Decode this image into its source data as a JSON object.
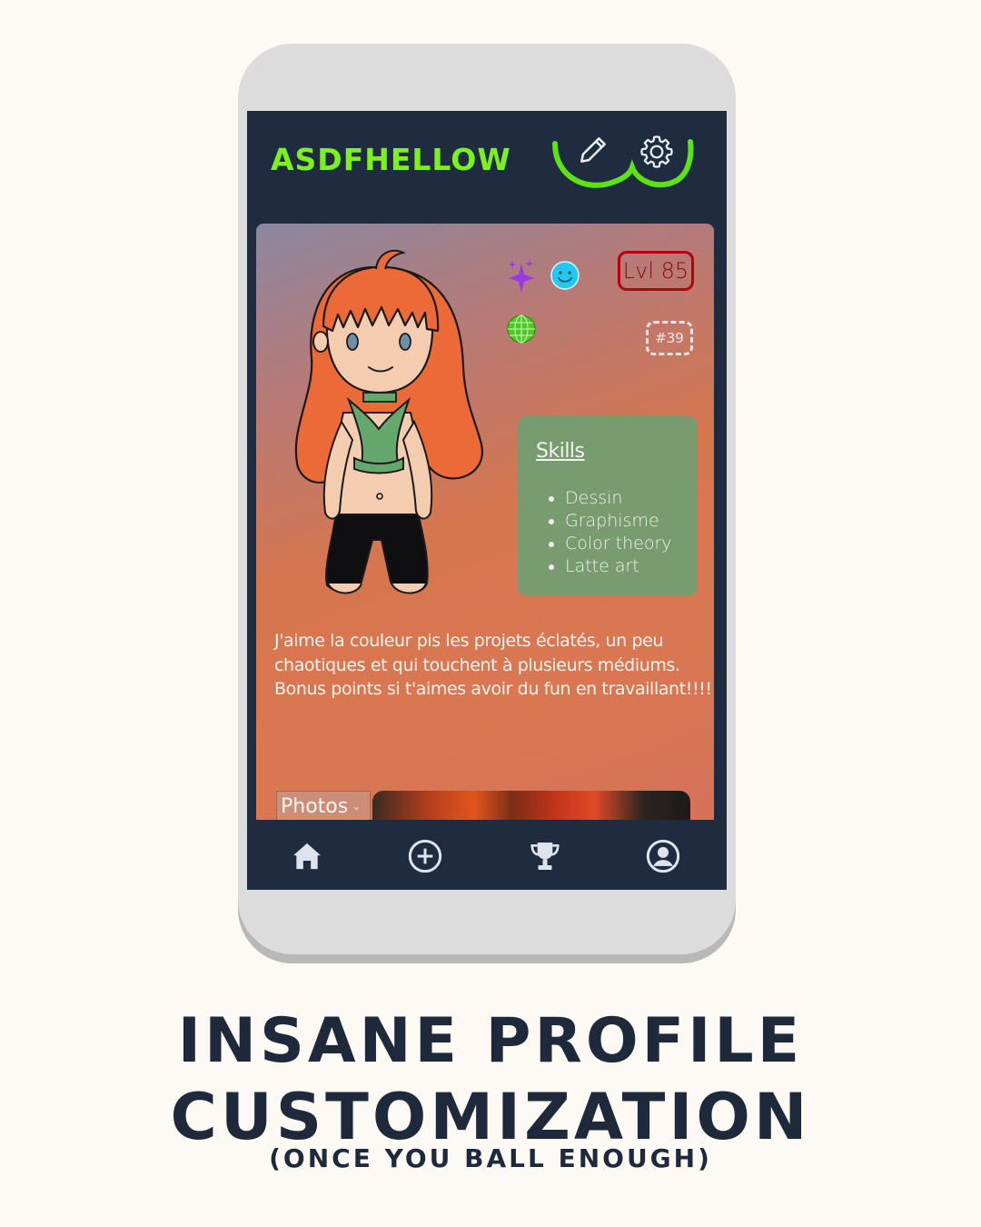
{
  "header": {
    "username": "ASDFHELLOW"
  },
  "profile": {
    "level": "Lvl 85",
    "rank": "#39",
    "skills": {
      "title": "Skills",
      "items": [
        "Dessin",
        "Graphisme",
        "Color theory",
        "Latte art"
      ]
    },
    "bio": "J'aime la couleur pis les projets éclatés, un peu chaotiques et qui touchent à plusieurs médiums. Bonus points si t'aimes avoir du fun en travaillant!!!!!",
    "photos": {
      "selected": "Photos"
    },
    "badges": [
      "sparkles-icon",
      "smiley-icon",
      "globe-icon"
    ]
  },
  "nav": {
    "items": [
      "home-icon",
      "plus-circle-icon",
      "trophy-icon",
      "user-circle-icon"
    ]
  },
  "caption": {
    "line1": "INSANE PROFILE",
    "line2": "CUSTOMIZATION",
    "line3": "(ONCE YOU BALL ENOUGH)"
  },
  "colors": {
    "accent": "#7df21a",
    "app_bg": "#1f2b3e",
    "skills_bg": "#789c6f",
    "level_border": "#b8000d",
    "caption": "#1e2a3c"
  }
}
